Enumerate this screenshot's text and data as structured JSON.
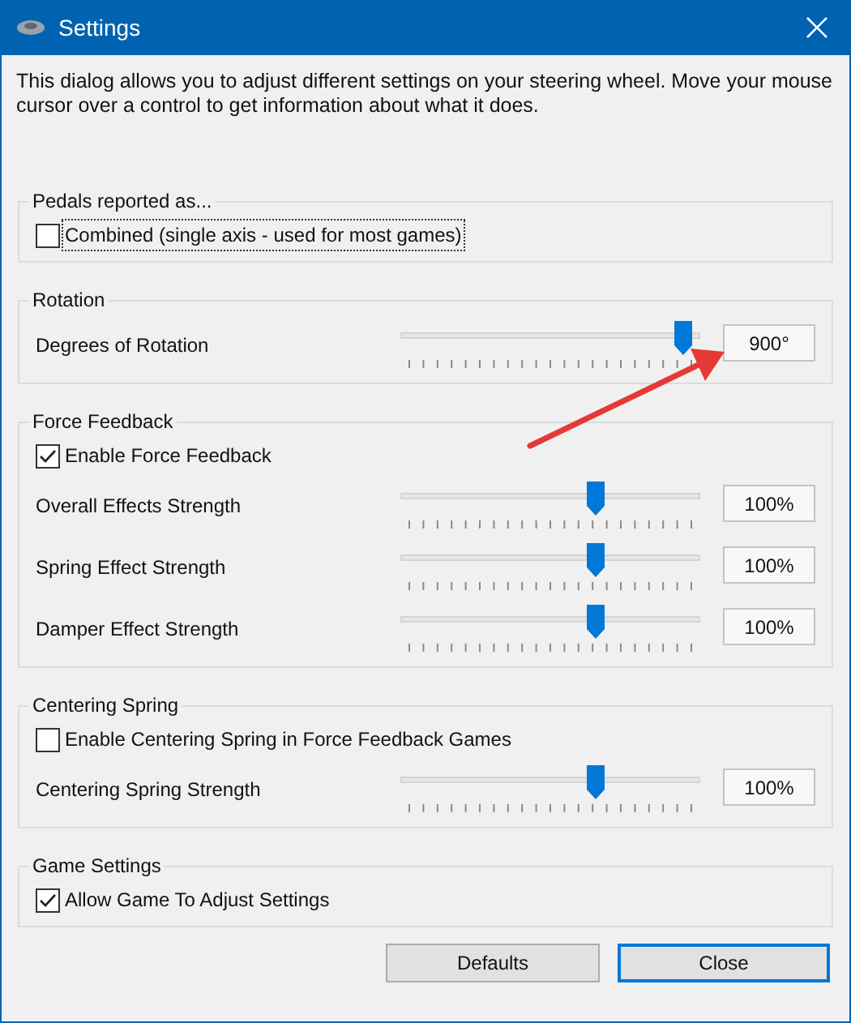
{
  "window": {
    "title": "Settings"
  },
  "intro": "This dialog allows you to adjust different settings on your steering wheel.  Move your mouse cursor over a control to get information about what it does.",
  "groups": [
    {
      "title": "Pedals reported as...",
      "rows": [
        {
          "kind": "checkbox",
          "label": "Combined (single axis - used for most games)",
          "checked": false,
          "focused": true
        }
      ]
    },
    {
      "title": "Rotation",
      "rows": [
        {
          "kind": "slider",
          "label": "Degrees of Rotation",
          "level": 0.97,
          "reading": "900°"
        }
      ]
    },
    {
      "title": "Force Feedback",
      "rows": [
        {
          "kind": "checkbox",
          "label": "Enable Force Feedback",
          "checked": true,
          "focused": false
        },
        {
          "kind": "slider",
          "label": "Overall Effects Strength",
          "level": 0.66,
          "reading": "100%"
        },
        {
          "kind": "slider",
          "label": "Spring Effect Strength",
          "level": 0.66,
          "reading": "100%"
        },
        {
          "kind": "slider",
          "label": "Damper Effect Strength",
          "level": 0.66,
          "reading": "100%"
        }
      ]
    },
    {
      "title": "Centering Spring",
      "rows": [
        {
          "kind": "checkbox",
          "label": "Enable Centering Spring in Force Feedback Games",
          "checked": false,
          "focused": false
        },
        {
          "kind": "slider",
          "label": "Centering Spring Strength",
          "level": 0.66,
          "reading": "100%"
        }
      ]
    },
    {
      "title": "Game Settings",
      "rows": [
        {
          "kind": "checkbox",
          "label": "Allow Game To Adjust Settings",
          "checked": true,
          "focused": false
        }
      ]
    }
  ],
  "buttons": [
    {
      "label": "Defaults",
      "default": false
    },
    {
      "label": "Close",
      "default": true
    }
  ]
}
